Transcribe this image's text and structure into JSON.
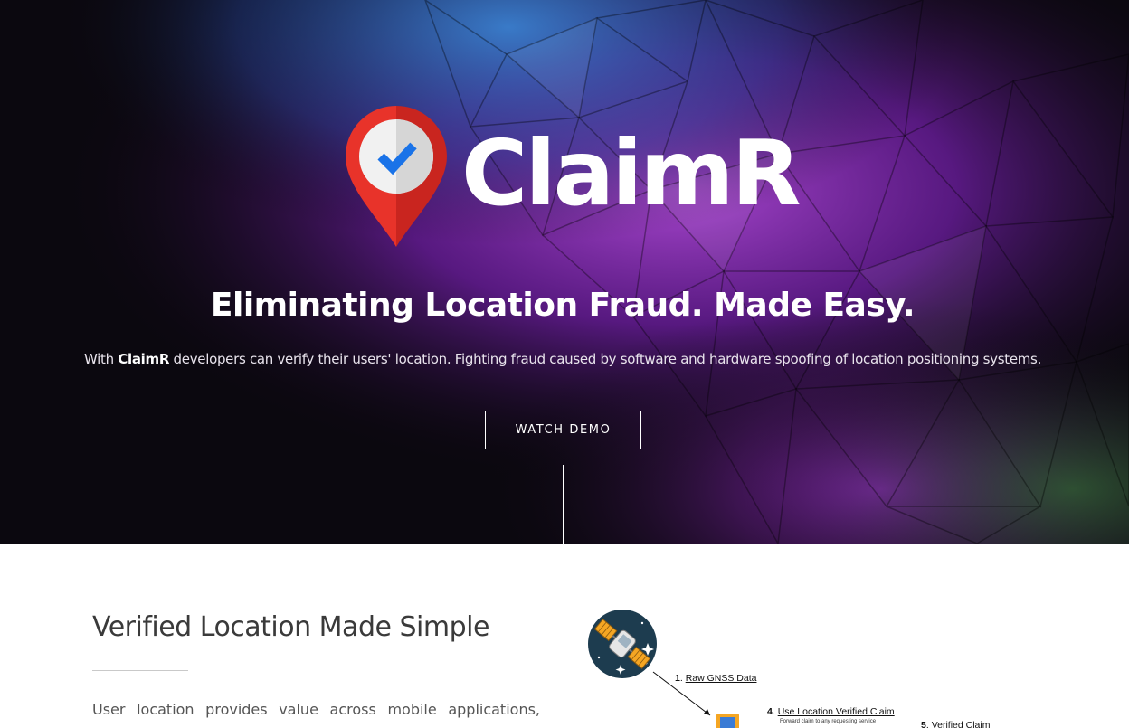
{
  "hero": {
    "brand": "ClaimR",
    "tagline": "Eliminating Location Fraud. Made Easy.",
    "subtext": {
      "prefix": "With ",
      "brand": "ClaimR",
      "rest": " developers can verify their users' location. Fighting fraud caused by software and hardware spoofing of location positioning systems."
    },
    "cta_label": "WATCH DEMO"
  },
  "section": {
    "title": "Verified Location Made Simple",
    "body": "User location provides value across mobile applications, while"
  },
  "diagram": {
    "steps": [
      {
        "num": "1",
        "label": "Raw GNSS Data"
      },
      {
        "num": "4",
        "label": "Use Location Verified  Claim",
        "sub": "Forward claim to any requesting service"
      },
      {
        "num": "5",
        "label": "Verified Claim"
      }
    ]
  },
  "colors": {
    "pin_red": "#e8332a",
    "pin_dark_red": "#c9251f",
    "check_blue": "#1a73e8",
    "satellite_bg": "#1d3c4f",
    "satellite_orange": "#f5a623"
  }
}
